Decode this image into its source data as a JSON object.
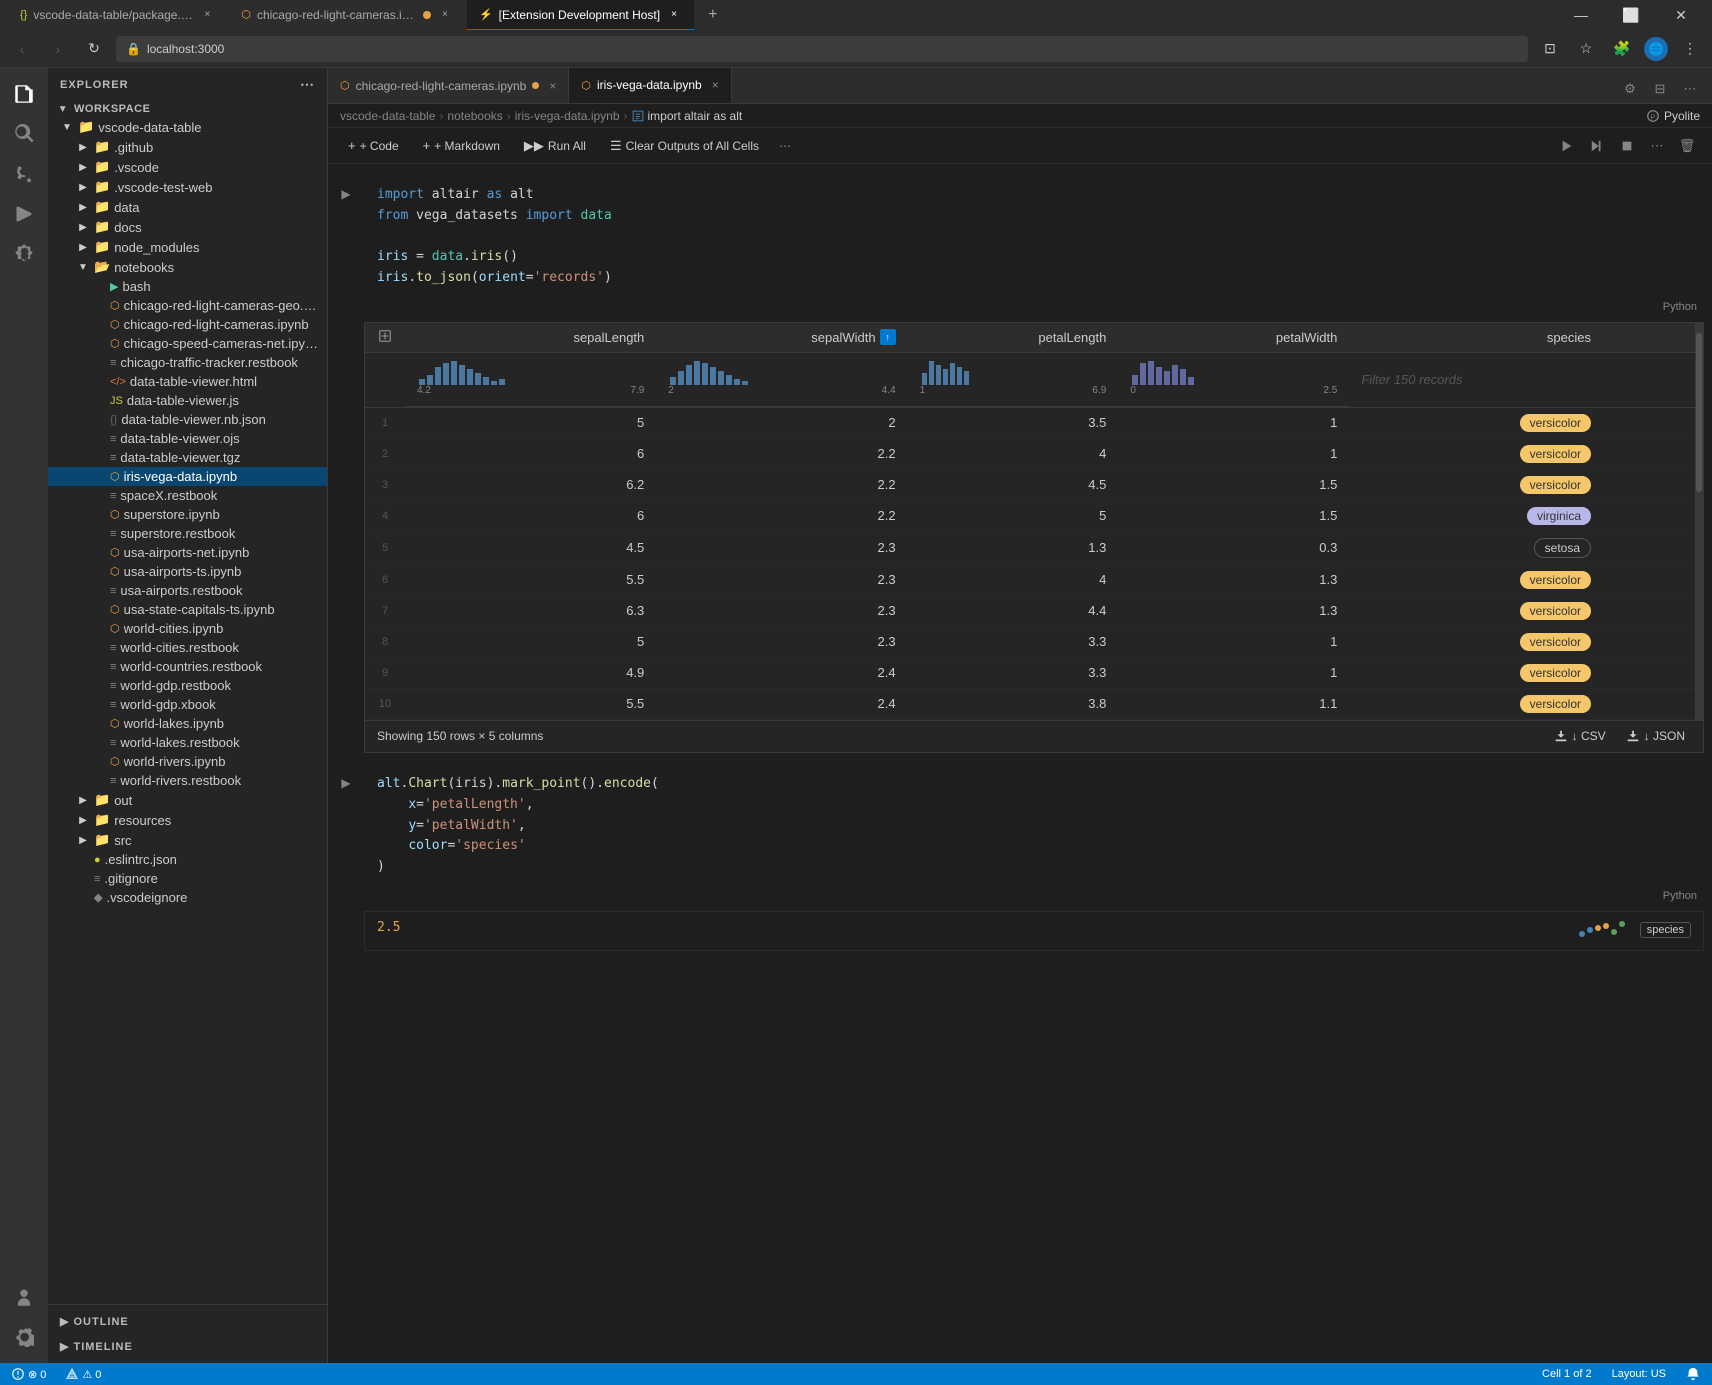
{
  "titlebar": {
    "tabs": [
      {
        "id": "tab1",
        "label": "vscode-data-table/package.json",
        "active": false,
        "icon": "json-icon"
      },
      {
        "id": "tab2",
        "label": "chicago-red-light-cameras.ipynb",
        "active": false,
        "dot": true,
        "icon": "notebook-icon"
      },
      {
        "id": "tab3",
        "label": "[Extension Development Host]",
        "active": true,
        "icon": "ext-icon"
      }
    ],
    "controls": [
      "minimize",
      "maximize",
      "close"
    ]
  },
  "browserbar": {
    "url": "localhost:3000",
    "back_disabled": true,
    "forward_disabled": true
  },
  "activitybar": {
    "items": [
      {
        "id": "explorer",
        "icon": "📋",
        "label": "Explorer",
        "active": true
      },
      {
        "id": "search",
        "icon": "🔍",
        "label": "Search",
        "active": false
      },
      {
        "id": "scm",
        "icon": "⎇",
        "label": "Source Control",
        "active": false
      },
      {
        "id": "debug",
        "icon": "▷",
        "label": "Run",
        "active": false
      },
      {
        "id": "extensions",
        "icon": "⊞",
        "label": "Extensions",
        "active": false
      }
    ],
    "bottom_items": [
      {
        "id": "accounts",
        "icon": "👤",
        "label": "Accounts"
      },
      {
        "id": "settings",
        "icon": "⚙",
        "label": "Settings"
      }
    ]
  },
  "sidebar": {
    "header": "EXPLORER",
    "workspace_label": "WORKSPACE",
    "tree": [
      {
        "id": "vscode-data-table",
        "type": "folder",
        "label": "vscode-data-table",
        "depth": 0,
        "expanded": true,
        "chevron": "▼"
      },
      {
        "id": "github",
        "type": "folder",
        "label": ".github",
        "depth": 1,
        "expanded": false,
        "chevron": "▶"
      },
      {
        "id": "vscode",
        "type": "folder",
        "label": ".vscode",
        "depth": 1,
        "expanded": false,
        "chevron": "▶"
      },
      {
        "id": "vscode-test-web",
        "type": "folder",
        "label": ".vscode-test-web",
        "depth": 1,
        "expanded": false,
        "chevron": "▶"
      },
      {
        "id": "data",
        "type": "folder",
        "label": "data",
        "depth": 1,
        "expanded": false,
        "chevron": "▶"
      },
      {
        "id": "docs",
        "type": "folder",
        "label": "docs",
        "depth": 1,
        "expanded": false,
        "chevron": "▶"
      },
      {
        "id": "node_modules",
        "type": "folder",
        "label": "node_modules",
        "depth": 1,
        "expanded": false,
        "chevron": "▶"
      },
      {
        "id": "notebooks",
        "type": "folder",
        "label": "notebooks",
        "depth": 1,
        "expanded": true,
        "chevron": "▼"
      },
      {
        "id": "bash",
        "type": "file",
        "label": "bash",
        "depth": 2,
        "icon_color": "#4ec9b0"
      },
      {
        "id": "chicago-red-geo",
        "type": "file",
        "label": "chicago-red-light-cameras-geo.ipynb",
        "depth": 2,
        "icon_color": "#e8a246"
      },
      {
        "id": "chicago-red",
        "type": "file",
        "label": "chicago-red-light-cameras.ipynb",
        "depth": 2,
        "dot": true,
        "icon_color": "#e8a246"
      },
      {
        "id": "chicago-speed",
        "type": "file",
        "label": "chicago-speed-cameras-net.ipynb",
        "depth": 2,
        "icon_color": "#e8a246"
      },
      {
        "id": "chicago-traffic",
        "type": "file",
        "label": "chicago-traffic-tracker.restbook",
        "depth": 2,
        "icon_color": "#858585"
      },
      {
        "id": "data-table-html",
        "type": "file",
        "label": "data-table-viewer.html",
        "depth": 2,
        "icon_color": "#e37933"
      },
      {
        "id": "data-table-js",
        "type": "file",
        "label": "data-table-viewer.js",
        "depth": 2,
        "icon_color": "#cbcb41"
      },
      {
        "id": "data-table-nb-json",
        "type": "file",
        "label": "data-table-viewer.nb.json",
        "depth": 2,
        "icon_color": "#666"
      },
      {
        "id": "data-table-ojs",
        "type": "file",
        "label": "data-table-viewer.ojs",
        "depth": 2,
        "icon_color": "#858585"
      },
      {
        "id": "data-table-tgz",
        "type": "file",
        "label": "data-table-viewer.tgz",
        "depth": 2,
        "icon_color": "#858585"
      },
      {
        "id": "iris-vega",
        "type": "file",
        "label": "iris-vega-data.ipynb",
        "depth": 2,
        "active": true,
        "icon_color": "#e8a246"
      },
      {
        "id": "spaceX",
        "type": "file",
        "label": "spaceX.restbook",
        "depth": 2,
        "icon_color": "#858585"
      },
      {
        "id": "superstore-ipynb",
        "type": "file",
        "label": "superstore.ipynb",
        "depth": 2,
        "icon_color": "#e8a246"
      },
      {
        "id": "superstore-rest",
        "type": "file",
        "label": "superstore.restbook",
        "depth": 2,
        "icon_color": "#858585"
      },
      {
        "id": "usa-airports-net",
        "type": "file",
        "label": "usa-airports-net.ipynb",
        "depth": 2,
        "icon_color": "#e8a246"
      },
      {
        "id": "usa-airports-ts",
        "type": "file",
        "label": "usa-airports-ts.ipynb",
        "depth": 2,
        "icon_color": "#e8a246"
      },
      {
        "id": "usa-airports-rest",
        "type": "file",
        "label": "usa-airports.restbook",
        "depth": 2,
        "icon_color": "#858585"
      },
      {
        "id": "usa-state-capitals",
        "type": "file",
        "label": "usa-state-capitals-ts.ipynb",
        "depth": 2,
        "icon_color": "#e8a246"
      },
      {
        "id": "world-cities-ipynb",
        "type": "file",
        "label": "world-cities.ipynb",
        "depth": 2,
        "icon_color": "#e8a246"
      },
      {
        "id": "world-cities-rest",
        "type": "file",
        "label": "world-cities.restbook",
        "depth": 2,
        "icon_color": "#858585"
      },
      {
        "id": "world-countries",
        "type": "file",
        "label": "world-countries.restbook",
        "depth": 2,
        "icon_color": "#858585"
      },
      {
        "id": "world-gdp-rest",
        "type": "file",
        "label": "world-gdp.restbook",
        "depth": 2,
        "icon_color": "#858585"
      },
      {
        "id": "world-gdp-xbook",
        "type": "file",
        "label": "world-gdp.xbook",
        "depth": 2,
        "icon_color": "#858585"
      },
      {
        "id": "world-lakes-ipynb",
        "type": "file",
        "label": "world-lakes.ipynb",
        "depth": 2,
        "icon_color": "#e8a246"
      },
      {
        "id": "world-lakes-rest",
        "type": "file",
        "label": "world-lakes.restbook",
        "depth": 2,
        "icon_color": "#858585"
      },
      {
        "id": "world-rivers-ipynb",
        "type": "file",
        "label": "world-rivers.ipynb",
        "depth": 2,
        "icon_color": "#e8a246"
      },
      {
        "id": "world-rivers-rest",
        "type": "file",
        "label": "world-rivers.restbook",
        "depth": 2,
        "icon_color": "#858585"
      },
      {
        "id": "out",
        "type": "folder",
        "label": "out",
        "depth": 1,
        "expanded": false,
        "chevron": "▶"
      },
      {
        "id": "resources",
        "type": "folder",
        "label": "resources",
        "depth": 1,
        "expanded": false,
        "chevron": "▶"
      },
      {
        "id": "src",
        "type": "folder",
        "label": "src",
        "depth": 1,
        "expanded": false,
        "chevron": "▶"
      },
      {
        "id": "eslintrc",
        "type": "file",
        "label": ".eslintrc.json",
        "depth": 1,
        "icon_color": "#cbcb41"
      },
      {
        "id": "gitignore",
        "type": "file",
        "label": ".gitignore",
        "depth": 1,
        "icon_color": "#858585"
      },
      {
        "id": "vscodeignore",
        "type": "file",
        "label": ".vscodeignore",
        "depth": 1,
        "icon_color": "#858585"
      }
    ],
    "outline_label": "OUTLINE",
    "timeline_label": "TIMELINE"
  },
  "editor": {
    "tabs": [
      {
        "id": "tab-chicago",
        "label": "chicago-red-light-cameras.ipynb",
        "active": false,
        "dot": true,
        "icon_color": "#e8a246"
      },
      {
        "id": "tab-iris",
        "label": "iris-vega-data.ipynb",
        "active": true,
        "icon_color": "#e8a246"
      }
    ],
    "breadcrumb": {
      "parts": [
        "vscode-data-table",
        "notebooks",
        "iris-vega-data.ipynb",
        "import altair as alt"
      ],
      "separators": [
        ">",
        ">",
        ">"
      ]
    },
    "kernel": "Pyolite",
    "notebook_toolbar": {
      "code_label": "+ Code",
      "markdown_label": "+ Markdown",
      "run_all_label": "Run All",
      "clear_outputs_label": "Clear Outputs of All Cells"
    },
    "cell1": {
      "code_lines": [
        {
          "parts": [
            {
              "text": "import",
              "cls": "kw"
            },
            {
              "text": " altair ",
              "cls": "code-white"
            },
            {
              "text": "as",
              "cls": "kw"
            },
            {
              "text": " alt",
              "cls": "code-white"
            }
          ]
        },
        {
          "parts": [
            {
              "text": "from",
              "cls": "kw"
            },
            {
              "text": " vega_datasets ",
              "cls": "code-white"
            },
            {
              "text": "import",
              "cls": "kw"
            },
            {
              "text": " data",
              "cls": "mod"
            }
          ]
        },
        {
          "parts": []
        },
        {
          "parts": [
            {
              "text": "iris",
              "cls": "var"
            },
            {
              "text": " = ",
              "cls": "code-white"
            },
            {
              "text": "data",
              "cls": "mod"
            },
            {
              "text": ".",
              "cls": "code-white"
            },
            {
              "text": "iris",
              "cls": "fn"
            },
            {
              "text": "()",
              "cls": "code-white"
            }
          ]
        },
        {
          "parts": [
            {
              "text": "iris",
              "cls": "var"
            },
            {
              "text": ".",
              "cls": "code-white"
            },
            {
              "text": "to_json",
              "cls": "fn"
            },
            {
              "text": "(",
              "cls": "code-white"
            },
            {
              "text": "orient",
              "cls": "var"
            },
            {
              "text": "=",
              "cls": "code-white"
            },
            {
              "text": "'records'",
              "cls": "str"
            },
            {
              "text": ")",
              "cls": "code-white"
            }
          ]
        }
      ]
    },
    "data_table": {
      "columns": [
        "sepalLength",
        "sepalWidth",
        "petalLength",
        "petalWidth",
        "species"
      ],
      "sort_col": "sepalWidth",
      "sort_dir": "asc",
      "filter_placeholder": "Filter 150 records",
      "rows": [
        {
          "sepalLength": "5",
          "sepalWidth": "2",
          "petalLength": "3.5",
          "petalWidth": "1",
          "species": "versicolor",
          "species_class": "species-versicolor"
        },
        {
          "sepalLength": "6",
          "sepalWidth": "2.2",
          "petalLength": "4",
          "petalWidth": "1",
          "species": "versicolor",
          "species_class": "species-versicolor"
        },
        {
          "sepalLength": "6.2",
          "sepalWidth": "2.2",
          "petalLength": "4.5",
          "petalWidth": "1.5",
          "species": "versicolor",
          "species_class": "species-versicolor"
        },
        {
          "sepalLength": "6",
          "sepalWidth": "2.2",
          "petalLength": "5",
          "petalWidth": "1.5",
          "species": "virginica",
          "species_class": "species-virginica"
        },
        {
          "sepalLength": "4.5",
          "sepalWidth": "2.3",
          "petalLength": "1.3",
          "petalWidth": "0.3",
          "species": "setosa",
          "species_class": "species-setosa"
        },
        {
          "sepalLength": "5.5",
          "sepalWidth": "2.3",
          "petalLength": "4",
          "petalWidth": "1.3",
          "species": "versicolor",
          "species_class": "species-versicolor"
        },
        {
          "sepalLength": "6.3",
          "sepalWidth": "2.3",
          "petalLength": "4.4",
          "petalWidth": "1.3",
          "species": "versicolor",
          "species_class": "species-versicolor"
        },
        {
          "sepalLength": "5",
          "sepalWidth": "2.3",
          "petalLength": "3.3",
          "petalWidth": "1",
          "species": "versicolor",
          "species_class": "species-versicolor"
        },
        {
          "sepalLength": "4.9",
          "sepalWidth": "2.4",
          "petalLength": "3.3",
          "petalWidth": "1",
          "species": "versicolor",
          "species_class": "species-versicolor"
        },
        {
          "sepalLength": "5.5",
          "sepalWidth": "2.4",
          "petalLength": "3.8",
          "petalWidth": "1.1",
          "species": "versicolor",
          "species_class": "species-versicolor"
        }
      ],
      "footer": {
        "showing": "Showing 150 rows × 5 columns",
        "csv_label": "↓ CSV",
        "json_label": "↓ JSON"
      },
      "ranges": {
        "sepalLength": {
          "min": "4.2",
          "max": "7.9"
        },
        "sepalWidth": {
          "min": "2",
          "max": "4.4"
        },
        "petalLength": {
          "min": "1",
          "max": "6.9"
        },
        "petalWidth": {
          "min": "0",
          "max": "2.5"
        }
      }
    },
    "cell2": {
      "code_lines": [
        {
          "parts": [
            {
              "text": "alt",
              "cls": "var"
            },
            {
              "text": ".",
              "cls": "code-white"
            },
            {
              "text": "Chart",
              "cls": "fn"
            },
            {
              "text": "(iris).",
              "cls": "code-white"
            },
            {
              "text": "mark_point",
              "cls": "fn"
            },
            {
              "text": "().",
              "cls": "code-white"
            },
            {
              "text": "encode",
              "cls": "fn"
            },
            {
              "text": "(",
              "cls": "code-white"
            }
          ]
        },
        {
          "parts": [
            {
              "text": "    x",
              "cls": "var"
            },
            {
              "text": "=",
              "cls": "code-white"
            },
            {
              "text": "'petalLength'",
              "cls": "str"
            },
            {
              "text": ",",
              "cls": "code-white"
            }
          ]
        },
        {
          "parts": [
            {
              "text": "    y",
              "cls": "var"
            },
            {
              "text": "=",
              "cls": "code-white"
            },
            {
              "text": "'petalWidth'",
              "cls": "str"
            },
            {
              "text": ",",
              "cls": "code-white"
            }
          ]
        },
        {
          "parts": [
            {
              "text": "    color",
              "cls": "var"
            },
            {
              "text": "=",
              "cls": "code-white"
            },
            {
              "text": "'species'",
              "cls": "str"
            }
          ]
        },
        {
          "parts": [
            {
              "text": ")",
              "cls": "code-white"
            }
          ]
        }
      ]
    }
  },
  "statusbar": {
    "left": [
      {
        "id": "errors",
        "text": "⊗ 0"
      },
      {
        "id": "warnings",
        "text": "⚠ 0"
      }
    ],
    "right": [
      {
        "id": "cell-info",
        "text": "Cell 1 of 2"
      },
      {
        "id": "layout",
        "text": "Layout: US"
      },
      {
        "id": "notifications",
        "icon": "🔔"
      }
    ]
  }
}
